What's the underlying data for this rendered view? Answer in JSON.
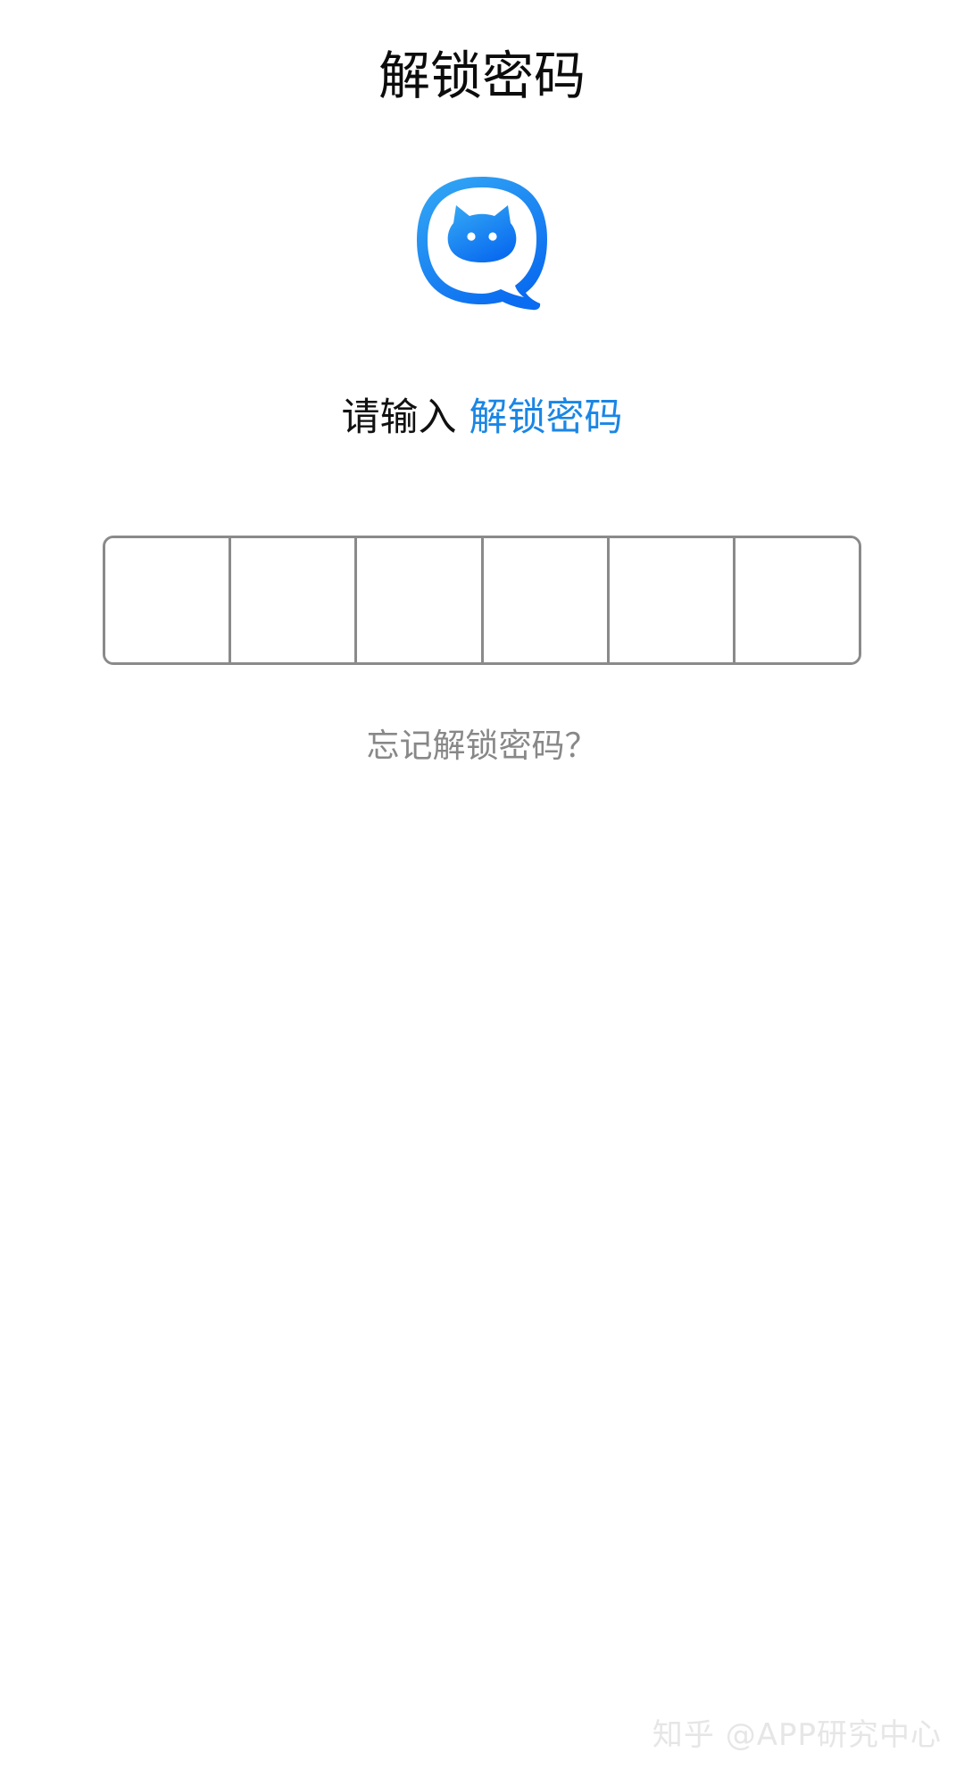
{
  "header": {
    "title": "解锁密码"
  },
  "logo": {
    "icon": "cat-chat-bubble-icon",
    "color_light": "#35aaf5",
    "color_dark": "#0a6cf0"
  },
  "prompt": {
    "prefix": "请输入",
    "highlight": "解锁密码",
    "highlight_color": "#1a86e5"
  },
  "pin": {
    "length": 6,
    "entered": ""
  },
  "forgot": {
    "label": "忘记解锁密码？"
  },
  "watermark": {
    "text": "知乎 @APP研究中心"
  }
}
